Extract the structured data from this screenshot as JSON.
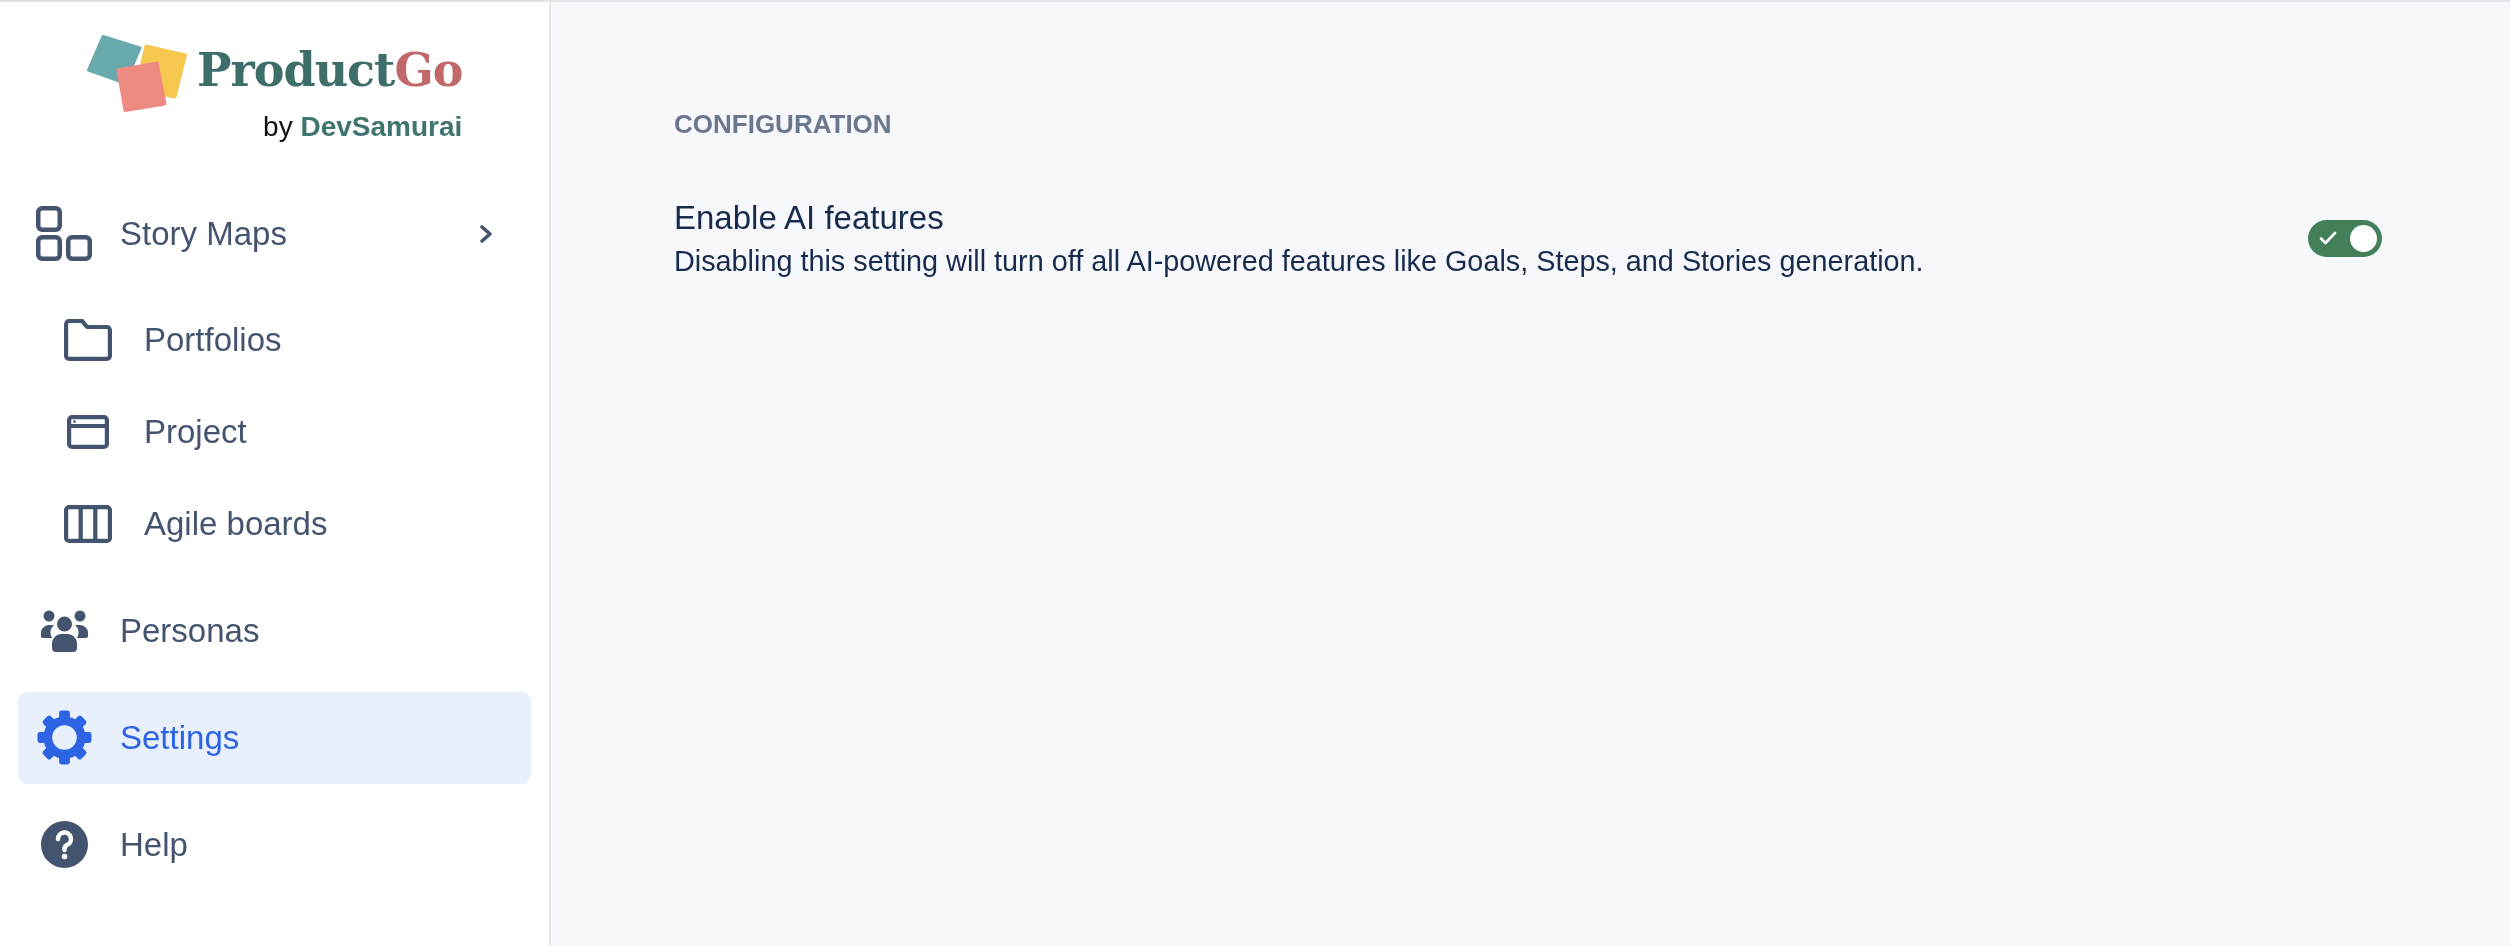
{
  "logo": {
    "wordmark": [
      "Product",
      "Go"
    ],
    "byline": {
      "prefix": "by",
      "name": "DevSamurai"
    }
  },
  "sidebar": {
    "items": [
      {
        "label": "Story Maps",
        "selected": false,
        "children": [
          {
            "label": "Portfolios",
            "selected": false
          },
          {
            "label": "Project",
            "selected": false
          },
          {
            "label": "Agile boards",
            "selected": false
          }
        ]
      },
      {
        "label": "Personas",
        "selected": false
      },
      {
        "label": "Settings",
        "selected": true
      },
      {
        "label": "Help",
        "selected": false
      }
    ]
  },
  "content": {
    "section_title": "CONFIGURATION",
    "settings": [
      {
        "title": "Enable AI features",
        "description": "Disabling this setting will turn off all AI-powered features like Goals, Steps, and Stories generation.",
        "on": true
      }
    ]
  }
}
